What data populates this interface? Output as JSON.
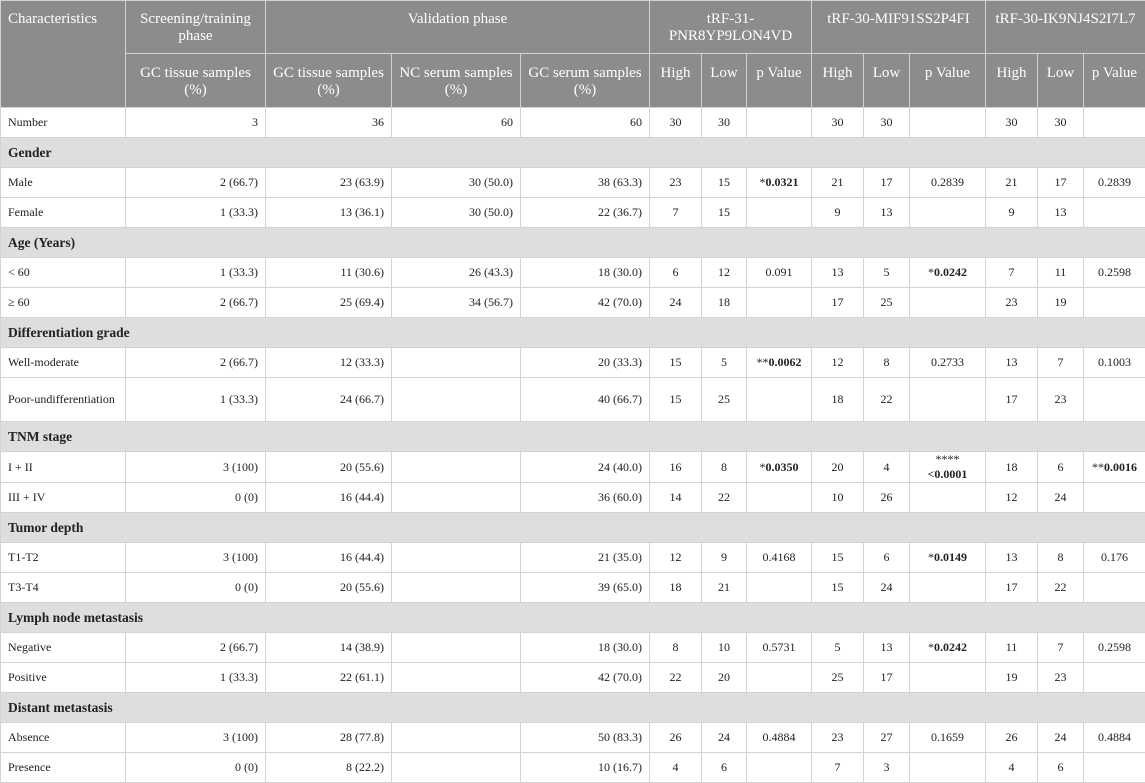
{
  "header": {
    "characteristics": "Characteristics",
    "screening_phase": "Screening/training phase",
    "validation_phase": "Validation phase",
    "trf1": "tRF-31-PNR8YP9LON4VD",
    "trf2": "tRF-30-MIF91SS2P4FI",
    "trf3": "tRF-30-IK9NJ4S2I7L7",
    "gc_tissue_screen": "GC tissue samples (%)",
    "gc_tissue_valid": "GC tissue samples (%)",
    "nc_serum": "NC serum samples (%)",
    "gc_serum": "GC serum samples (%)",
    "high": "High",
    "low": "Low",
    "p_value_1": "p Value",
    "p_value_2": "p Value",
    "p_value_3": "p Value"
  },
  "rows": [
    {
      "type": "data",
      "label": "Number",
      "screen": "3",
      "gc_tissue": "36",
      "nc_serum": "60",
      "gc_serum": "60",
      "t1": {
        "high": "30",
        "low": "30",
        "p": ""
      },
      "t2": {
        "high": "30",
        "low": "30",
        "p": ""
      },
      "t3": {
        "high": "30",
        "low": "30",
        "p": ""
      }
    },
    {
      "type": "section",
      "label": "Gender"
    },
    {
      "type": "data",
      "label": "Male",
      "screen": "2 (66.7)",
      "gc_tissue": "23 (63.9)",
      "nc_serum": "30 (50.0)",
      "gc_serum": "38 (63.3)",
      "t1": {
        "high": "23",
        "low": "15",
        "p_prefix": "*",
        "p": "0.0321",
        "p_bold": true
      },
      "t2": {
        "high": "21",
        "low": "17",
        "p": "0.2839"
      },
      "t3": {
        "high": "21",
        "low": "17",
        "p": "0.2839"
      }
    },
    {
      "type": "data",
      "label": "Female",
      "screen": "1 (33.3)",
      "gc_tissue": "13 (36.1)",
      "nc_serum": "30 (50.0)",
      "gc_serum": "22 (36.7)",
      "t1": {
        "high": "7",
        "low": "15",
        "p": ""
      },
      "t2": {
        "high": "9",
        "low": "13",
        "p": ""
      },
      "t3": {
        "high": "9",
        "low": "13",
        "p": ""
      }
    },
    {
      "type": "section",
      "label": "Age (Years)"
    },
    {
      "type": "data",
      "label": "< 60",
      "screen": "1 (33.3)",
      "gc_tissue": "11 (30.6)",
      "nc_serum": "26 (43.3)",
      "gc_serum": "18 (30.0)",
      "t1": {
        "high": "6",
        "low": "12",
        "p": "0.091"
      },
      "t2": {
        "high": "13",
        "low": "5",
        "p_prefix": "*",
        "p": "0.0242",
        "p_bold": true
      },
      "t3": {
        "high": "7",
        "low": "11",
        "p": "0.2598"
      }
    },
    {
      "type": "data",
      "label": "≥ 60",
      "screen": "2 (66.7)",
      "gc_tissue": "25 (69.4)",
      "nc_serum": "34 (56.7)",
      "gc_serum": "42 (70.0)",
      "t1": {
        "high": "24",
        "low": "18",
        "p": ""
      },
      "t2": {
        "high": "17",
        "low": "25",
        "p": ""
      },
      "t3": {
        "high": "23",
        "low": "19",
        "p": ""
      }
    },
    {
      "type": "section",
      "label": "Differentiation grade"
    },
    {
      "type": "data",
      "label": "Well-moderate",
      "screen": "2 (66.7)",
      "gc_tissue": "12 (33.3)",
      "nc_serum": "",
      "gc_serum": "20 (33.3)",
      "t1": {
        "high": "15",
        "low": "5",
        "p_prefix": "**",
        "p": "0.0062",
        "p_bold": true
      },
      "t2": {
        "high": "12",
        "low": "8",
        "p": "0.2733"
      },
      "t3": {
        "high": "13",
        "low": "7",
        "p": "0.1003"
      }
    },
    {
      "type": "data",
      "tall": true,
      "label": "Poor-undifferentiation",
      "screen": "1 (33.3)",
      "gc_tissue": "24 (66.7)",
      "nc_serum": "",
      "gc_serum": "40 (66.7)",
      "t1": {
        "high": "15",
        "low": "25",
        "p": ""
      },
      "t2": {
        "high": "18",
        "low": "22",
        "p": ""
      },
      "t3": {
        "high": "17",
        "low": "23",
        "p": ""
      }
    },
    {
      "type": "section",
      "label": "TNM stage"
    },
    {
      "type": "data",
      "label": "I + II",
      "screen": "3 (100)",
      "gc_tissue": "20 (55.6)",
      "nc_serum": "",
      "gc_serum": "24 (40.0)",
      "t1": {
        "high": "16",
        "low": "8",
        "p_prefix": "*",
        "p": "0.0350",
        "p_bold": true
      },
      "t2": {
        "high": "20",
        "low": "4",
        "p_prefix": "****",
        "p": "<0.0001",
        "p_bold": true
      },
      "t3": {
        "high": "18",
        "low": "6",
        "p_prefix": "**",
        "p": "0.0016",
        "p_bold": true
      }
    },
    {
      "type": "data",
      "label": "III + IV",
      "screen": "0 (0)",
      "gc_tissue": "16 (44.4)",
      "nc_serum": "",
      "gc_serum": "36 (60.0)",
      "t1": {
        "high": "14",
        "low": "22",
        "p": ""
      },
      "t2": {
        "high": "10",
        "low": "26",
        "p": ""
      },
      "t3": {
        "high": "12",
        "low": "24",
        "p": ""
      }
    },
    {
      "type": "section",
      "label": "Tumor depth"
    },
    {
      "type": "data",
      "label": "T1-T2",
      "screen": "3 (100)",
      "gc_tissue": "16 (44.4)",
      "nc_serum": "",
      "gc_serum": "21 (35.0)",
      "t1": {
        "high": "12",
        "low": "9",
        "p": "0.4168"
      },
      "t2": {
        "high": "15",
        "low": "6",
        "p_prefix": "*",
        "p": "0.0149",
        "p_bold": true
      },
      "t3": {
        "high": "13",
        "low": "8",
        "p": "0.176"
      }
    },
    {
      "type": "data",
      "label": "T3-T4",
      "screen": "0 (0)",
      "gc_tissue": "20 (55.6)",
      "nc_serum": "",
      "gc_serum": "39 (65.0)",
      "t1": {
        "high": "18",
        "low": "21",
        "p": ""
      },
      "t2": {
        "high": "15",
        "low": "24",
        "p": ""
      },
      "t3": {
        "high": "17",
        "low": "22",
        "p": ""
      }
    },
    {
      "type": "section",
      "label": "Lymph node metastasis"
    },
    {
      "type": "data",
      "label": "Negative",
      "screen": "2 (66.7)",
      "gc_tissue": "14 (38.9)",
      "nc_serum": "",
      "gc_serum": "18 (30.0)",
      "t1": {
        "high": "8",
        "low": "10",
        "p": "0.5731"
      },
      "t2": {
        "high": "5",
        "low": "13",
        "p_prefix": "*",
        "p": "0.0242",
        "p_bold": true
      },
      "t3": {
        "high": "11",
        "low": "7",
        "p": "0.2598"
      }
    },
    {
      "type": "data",
      "label": "Positive",
      "screen": "1 (33.3)",
      "gc_tissue": "22 (61.1)",
      "nc_serum": "",
      "gc_serum": "42 (70.0)",
      "t1": {
        "high": "22",
        "low": "20",
        "p": ""
      },
      "t2": {
        "high": "25",
        "low": "17",
        "p": ""
      },
      "t3": {
        "high": "19",
        "low": "23",
        "p": ""
      }
    },
    {
      "type": "section",
      "label": "Distant metastasis"
    },
    {
      "type": "data",
      "label": "Absence",
      "screen": "3 (100)",
      "gc_tissue": "28 (77.8)",
      "nc_serum": "",
      "gc_serum": "50 (83.3)",
      "t1": {
        "high": "26",
        "low": "24",
        "p": "0.4884"
      },
      "t2": {
        "high": "23",
        "low": "27",
        "p": "0.1659"
      },
      "t3": {
        "high": "26",
        "low": "24",
        "p": "0.4884"
      }
    },
    {
      "type": "data",
      "label": "Presence",
      "screen": "0 (0)",
      "gc_tissue": "8 (22.2)",
      "nc_serum": "",
      "gc_serum": "10 (16.7)",
      "t1": {
        "high": "4",
        "low": "6",
        "p": ""
      },
      "t2": {
        "high": "7",
        "low": "3",
        "p": ""
      },
      "t3": {
        "high": "4",
        "low": "6",
        "p": ""
      }
    }
  ]
}
